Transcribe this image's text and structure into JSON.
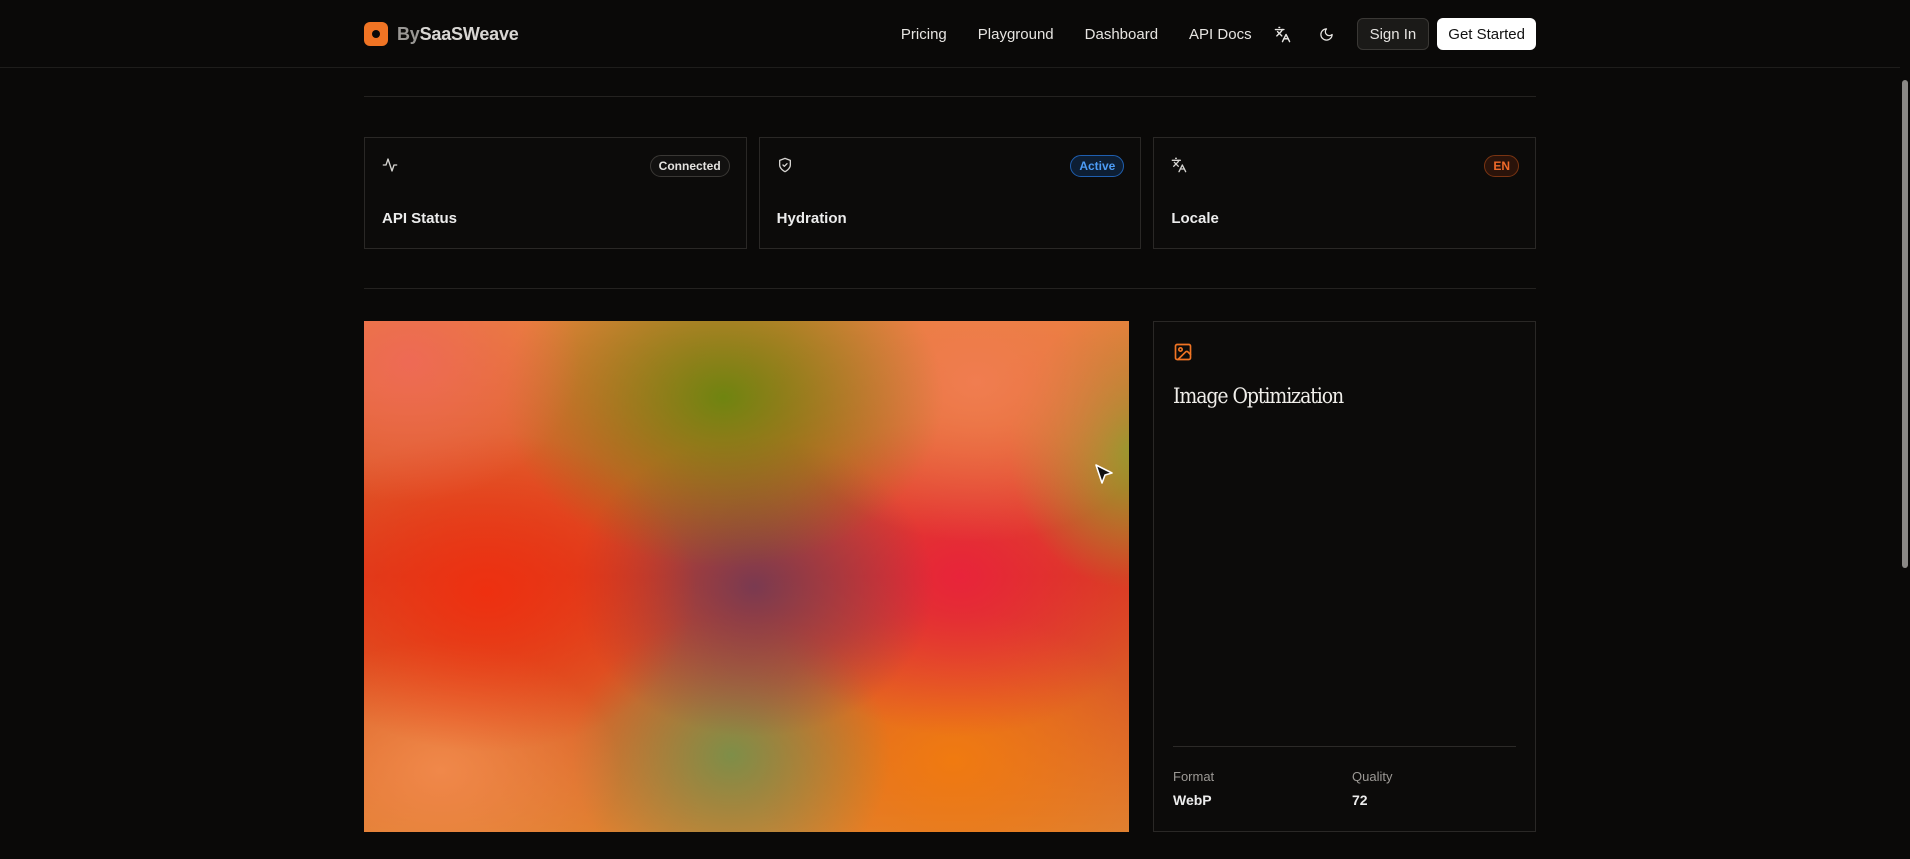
{
  "header": {
    "brand": {
      "prefix": "By",
      "name": "SaaSWeave"
    },
    "nav": [
      "Pricing",
      "Playground",
      "Dashboard",
      "API Docs"
    ],
    "icons": [
      "translate-icon",
      "moon-icon"
    ],
    "sign_in": "Sign In",
    "get_started": "Get Started"
  },
  "status_cards": [
    {
      "icon": "activity-icon",
      "label": "API Status",
      "badge": "Connected"
    },
    {
      "icon": "shield-icon",
      "label": "Hydration",
      "badge": "Active"
    },
    {
      "icon": "translate-icon",
      "label": "Locale",
      "badge": "EN"
    }
  ],
  "image_panel": {
    "icon": "image-icon",
    "title": "Image Optimization",
    "format_label": "Format",
    "format_value": "WebP",
    "quality_label": "Quality",
    "quality_value": "72"
  },
  "colors": {
    "accent": "#f07424",
    "active_blue": "#4d9cf5",
    "background": "#0a0908"
  }
}
